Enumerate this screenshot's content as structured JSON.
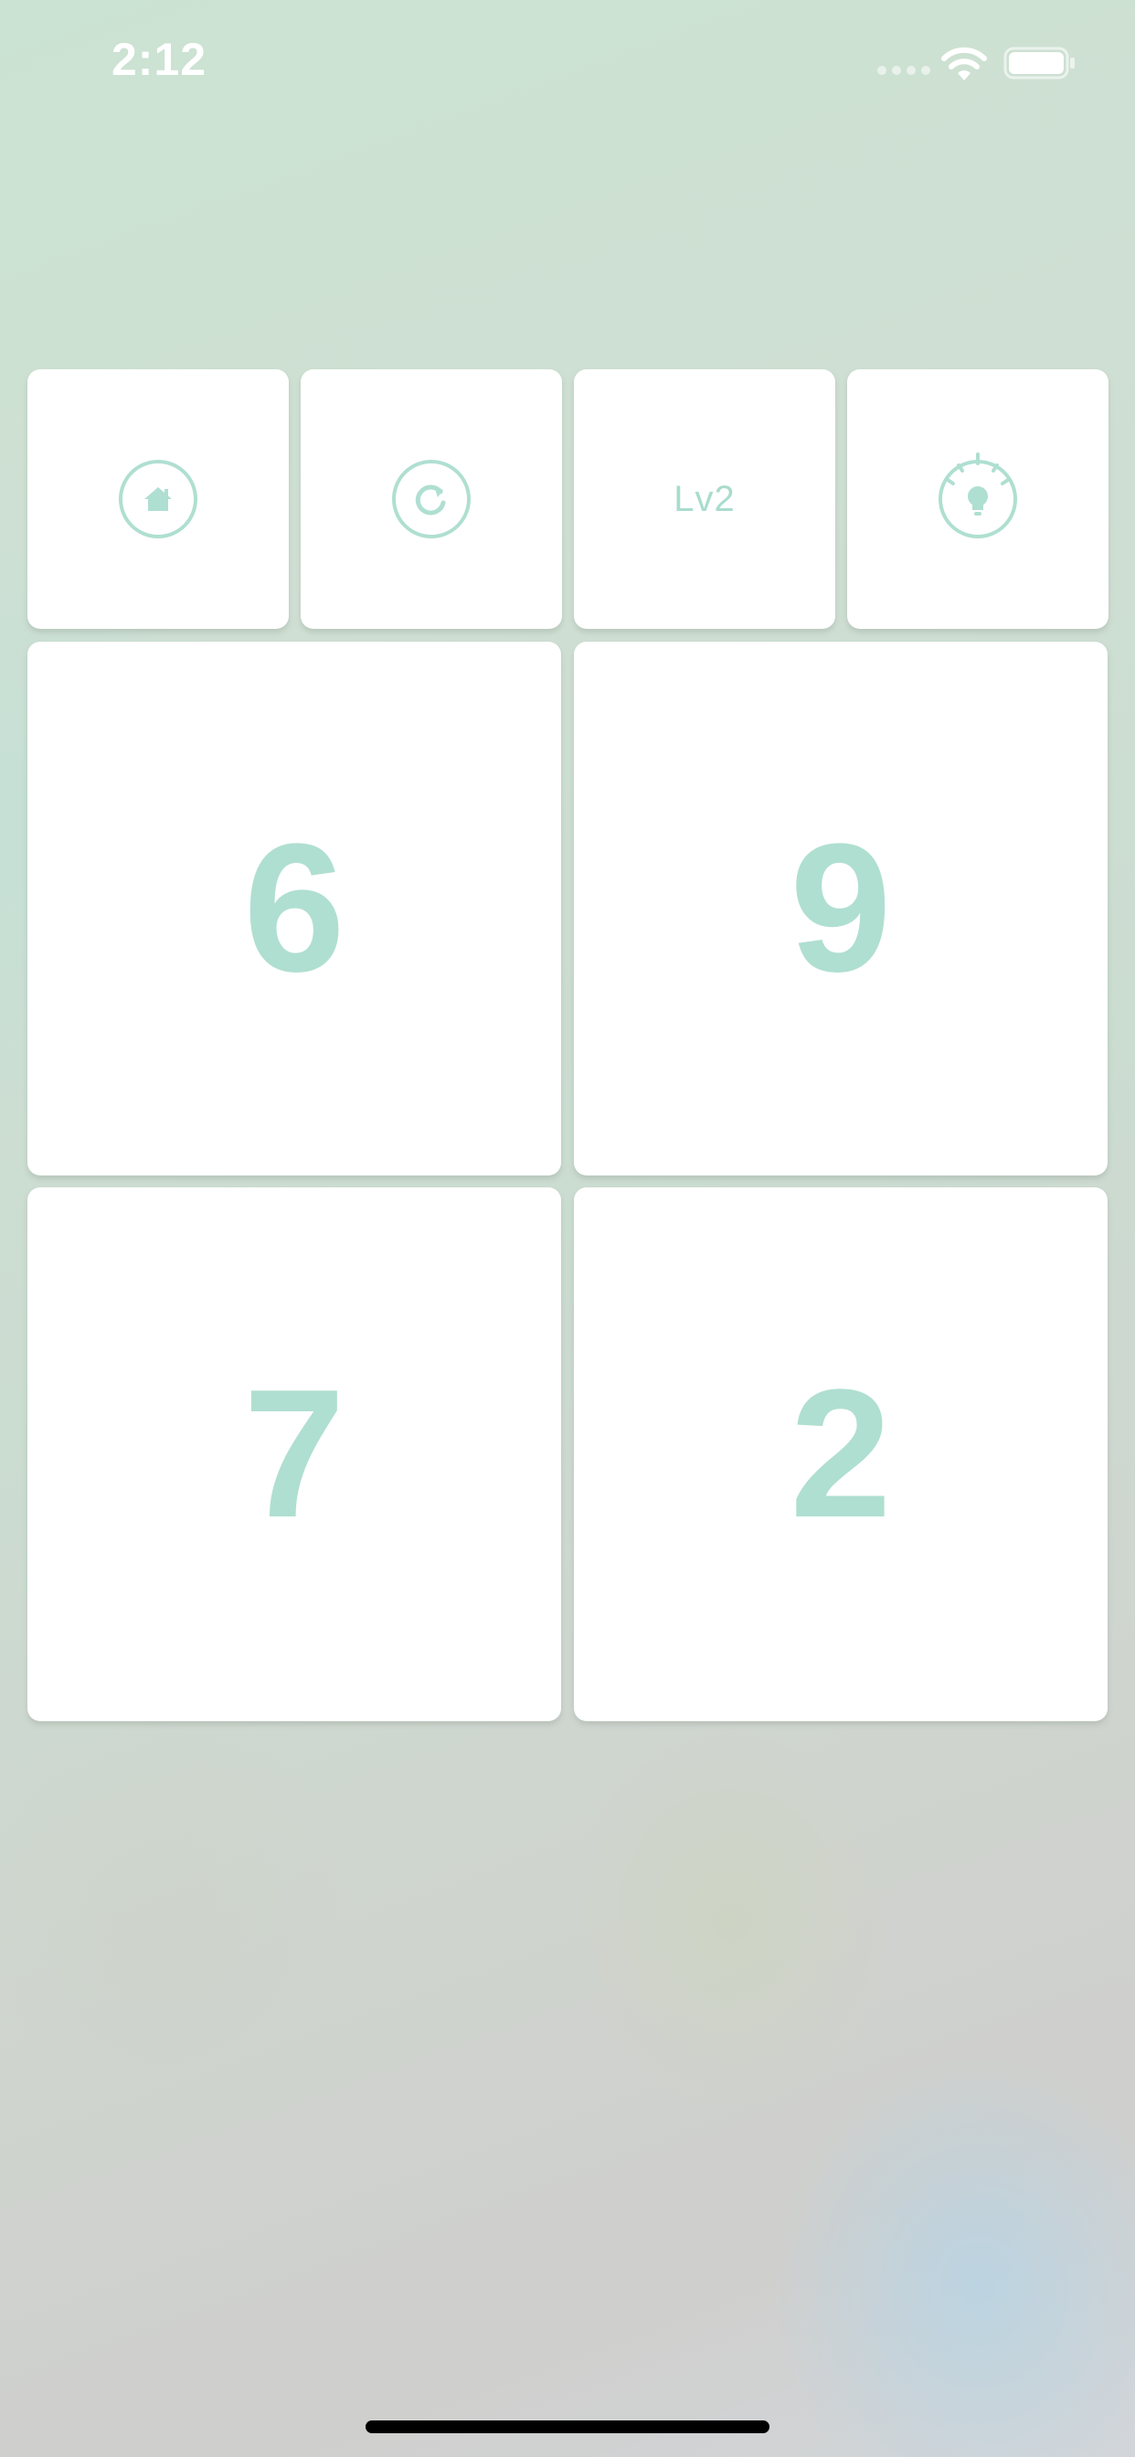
{
  "status_bar": {
    "time": "2:12"
  },
  "toolbar": {
    "home": {
      "icon": "home-icon"
    },
    "restart": {
      "icon": "restart-icon"
    },
    "level": "Lv2",
    "hint": {
      "icon": "lightbulb-icon"
    }
  },
  "number_cards": [
    "6",
    "9",
    "7",
    "2"
  ],
  "colors": {
    "accent": "#afdfd1",
    "tile": "#ffffff",
    "status_text": "#ffffff"
  }
}
